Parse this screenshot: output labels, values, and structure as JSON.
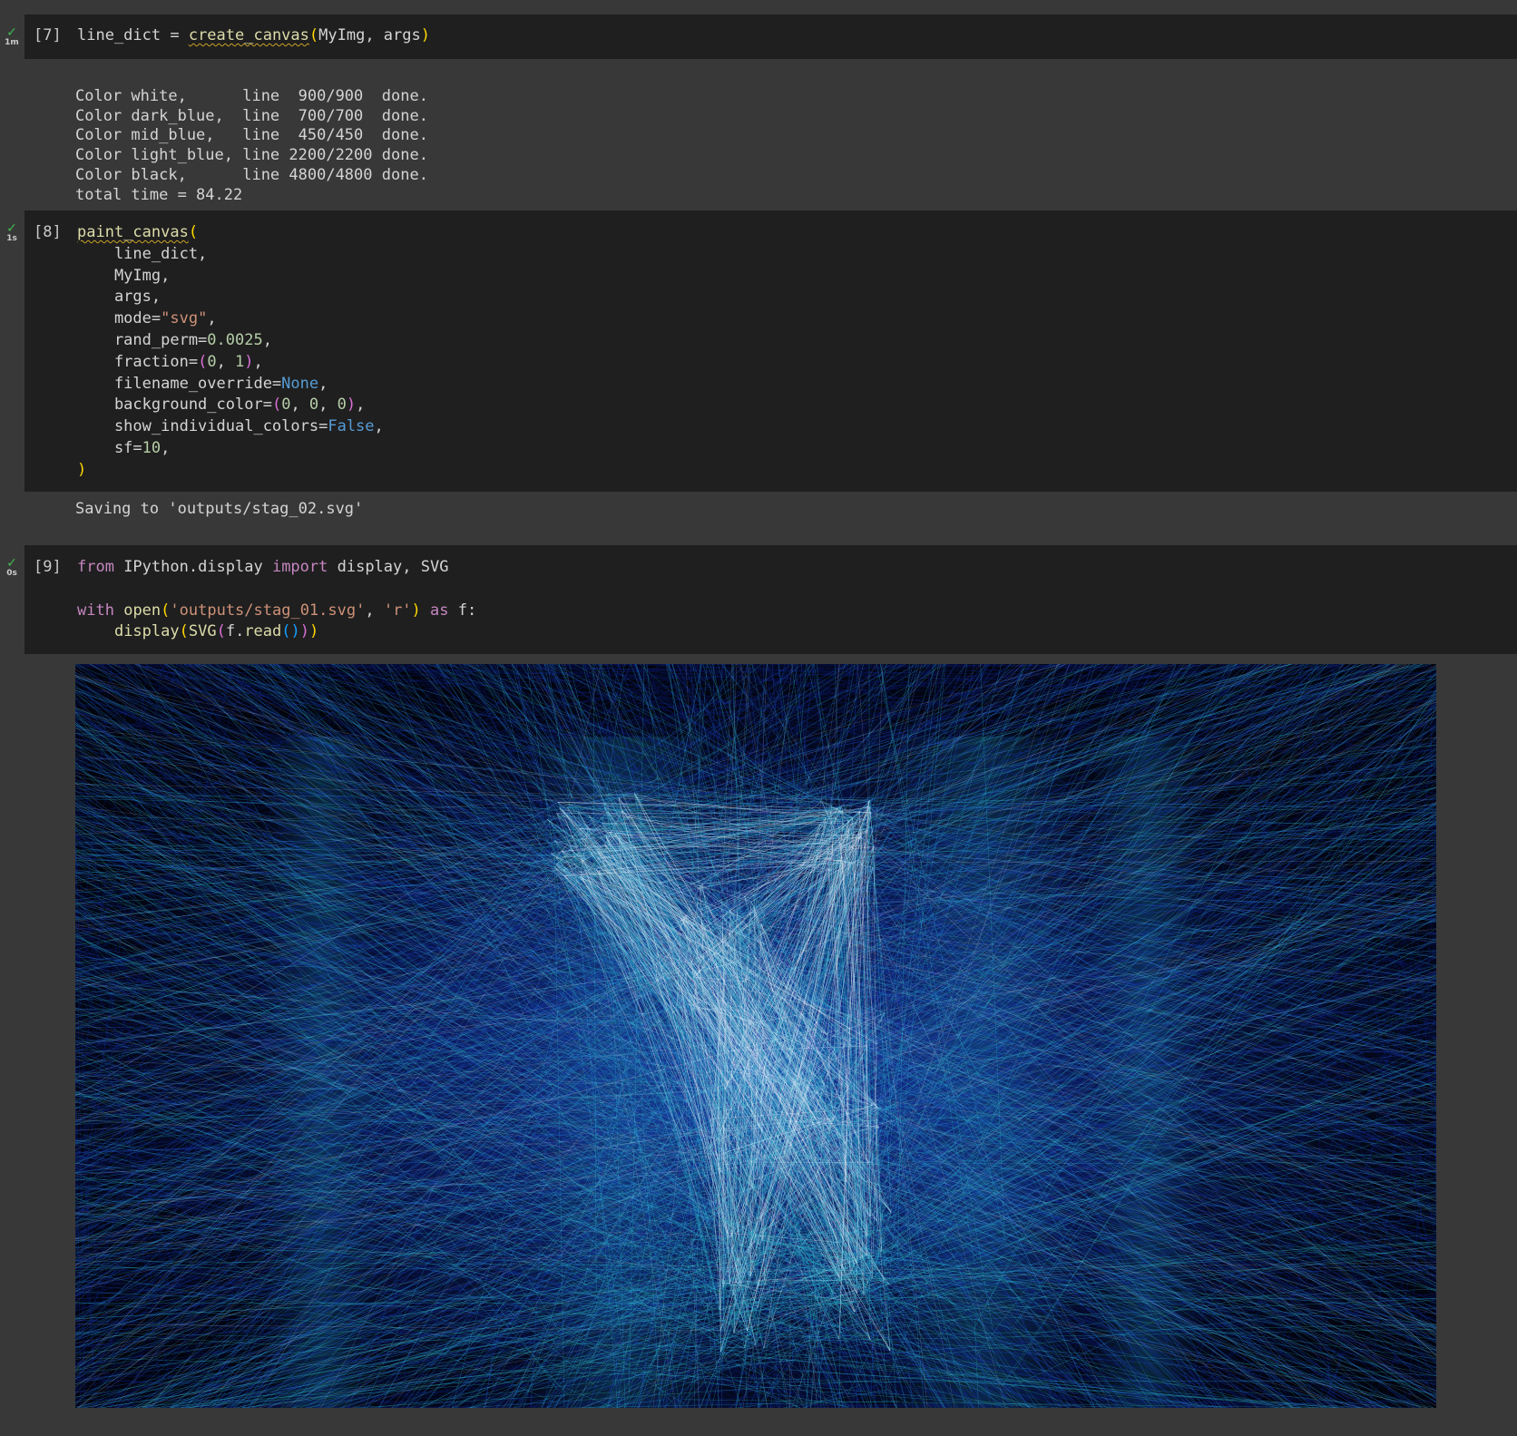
{
  "cells": [
    {
      "exec_count": "[7]",
      "status_icon": "check-icon",
      "status_time": "1m",
      "code_lines": [
        "line_dict = create_canvas(MyImg, args)"
      ],
      "output_lines": [
        "Color white,      line  900/900  done.",
        "Color dark_blue,  line  700/700  done.",
        "Color mid_blue,   line  450/450  done.",
        "Color light_blue, line 2200/2200 done.",
        "Color black,      line 4800/4800 done.",
        "total time = 84.22"
      ]
    },
    {
      "exec_count": "[8]",
      "status_icon": "check-icon",
      "status_time": "1s",
      "code_lines": [
        "paint_canvas(",
        "    line_dict,",
        "    MyImg,",
        "    args,",
        "    mode=\"svg\",",
        "    rand_perm=0.0025,",
        "    fraction=(0, 1),",
        "    filename_override=None,",
        "    background_color=(0, 0, 0),",
        "    show_individual_colors=False,",
        "    sf=10,",
        ")"
      ],
      "output_lines": [
        "Saving to 'outputs/stag_02.svg'"
      ]
    },
    {
      "exec_count": "[9]",
      "status_icon": "check-icon",
      "status_time": "0s",
      "code_lines": [
        "from IPython.display import display, SVG",
        "",
        "with open('outputs/stag_01.svg', 'r') as f:",
        "    display(SVG(f.read()))"
      ],
      "output_image": "string-art-stag-image"
    }
  ],
  "theme": {
    "background": "#383838",
    "cell_background": "#1f1f1f",
    "keyword": "#c586c0",
    "function": "#dcdcaa",
    "string": "#ce9178",
    "number": "#b5cea8",
    "constant": "#569cd6",
    "status_ok": "#3fb950"
  },
  "art_colors": {
    "background": "#02040e",
    "white": "#e6eef8",
    "dark_blue": "#0b1c7a",
    "mid_blue": "#1f4fd0",
    "light_blue": "#2aa7c9"
  }
}
